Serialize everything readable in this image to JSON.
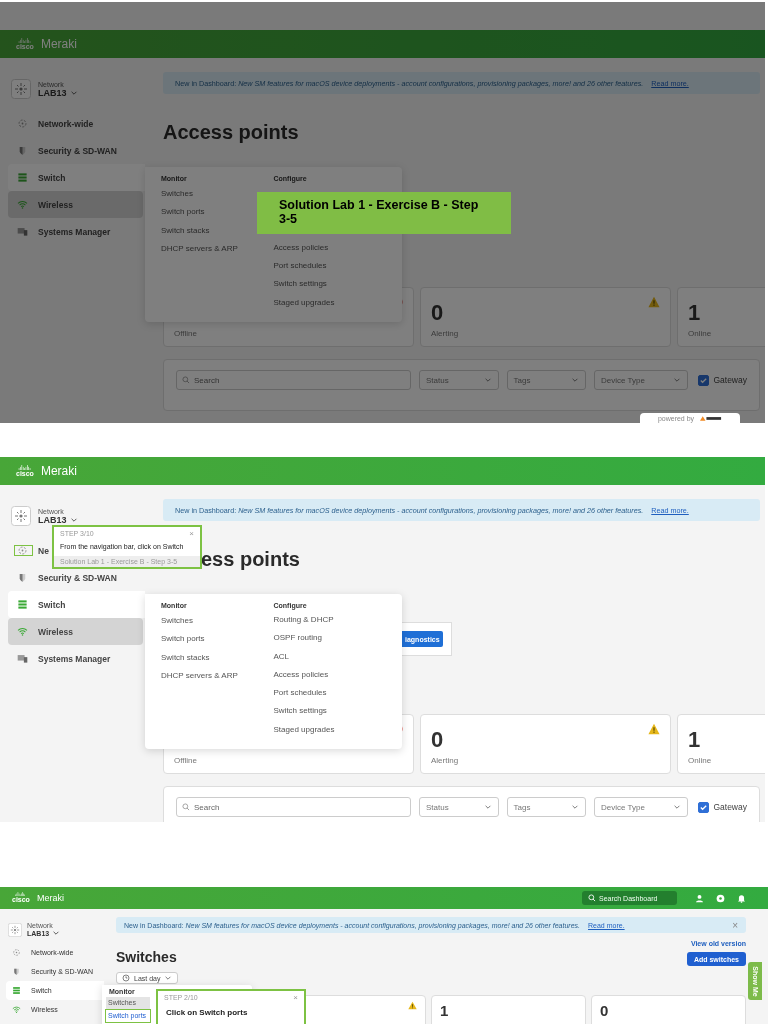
{
  "panels": [
    {
      "kind": "access_points",
      "dimmed": true,
      "header": {
        "logo": "cisco",
        "brand": "Meraki"
      },
      "network": {
        "label": "Network",
        "name": "LAB13"
      },
      "nav": [
        {
          "label": "Network-wide",
          "selected": false,
          "current": false
        },
        {
          "label": "Security & SD-WAN",
          "selected": false,
          "current": false
        },
        {
          "label": "Switch",
          "selected": true,
          "current": false
        },
        {
          "label": "Wireless",
          "selected": false,
          "current": true
        },
        {
          "label": "Systems Manager",
          "selected": false,
          "current": false
        }
      ],
      "banner": {
        "text": "New in Dashboard: *New SM features for macOS device deployments - account configurations, provisioning packages, more! and 26 other features.*",
        "link": "Read more."
      },
      "title": "Access points",
      "flyout": {
        "columns": [
          {
            "heading": "Monitor",
            "items": [
              {
                "label": "Switches"
              },
              {
                "label": "Switch ports"
              },
              {
                "label": "Switch stacks"
              },
              {
                "label": "DHCP servers & ARP"
              }
            ]
          },
          {
            "heading": "Configure",
            "items": [
              {
                "label": "Access policies"
              },
              {
                "label": "Port schedules"
              },
              {
                "label": "Switch settings"
              },
              {
                "label": "Staged upgrades"
              }
            ]
          }
        ]
      },
      "stats": [
        {
          "label": "Offline",
          "kind": "error"
        },
        {
          "value": "0",
          "label": "Alerting",
          "kind": "warning"
        },
        {
          "value": "1",
          "label": "Online",
          "kind": "plain"
        }
      ],
      "filters": {
        "search_placeholder": "Search",
        "selects": [
          "Status",
          "Tags",
          "Device Type"
        ],
        "checkbox": {
          "label": "Gateway",
          "checked": true
        }
      },
      "step_title": "Solution Lab 1 - Exercise B - Step 3-5",
      "powered_by": "powered by"
    },
    {
      "kind": "access_points",
      "header": {
        "logo": "cisco",
        "brand": "Meraki"
      },
      "network": {
        "label": "Network",
        "name": "LAB13"
      },
      "nav": [
        {
          "label": "Ne",
          "selected": false,
          "current": false,
          "highlighted": true
        },
        {
          "label": "Security & SD-WAN",
          "selected": false,
          "current": false,
          "highlighted": false
        },
        {
          "label": "Switch",
          "selected": true,
          "current": false,
          "highlighted": false
        },
        {
          "label": "Wireless",
          "selected": false,
          "current": true,
          "highlighted": false
        },
        {
          "label": "Systems Manager",
          "selected": false,
          "current": false,
          "highlighted": false
        }
      ],
      "banner": {
        "text": "New in Dashboard: *New SM features for macOS device deployments - account configurations, provisioning packages, more! and 26 other features.*",
        "link": "Read more."
      },
      "title": "ess points",
      "diagnostics_button": "iagnostics",
      "flyout": {
        "columns": [
          {
            "heading": "Monitor",
            "items": [
              {
                "label": "Switches"
              },
              {
                "label": "Switch ports"
              },
              {
                "label": "Switch stacks"
              },
              {
                "label": "DHCP servers & ARP"
              }
            ]
          },
          {
            "heading": "Configure",
            "items": [
              {
                "label": "Routing & DHCP"
              },
              {
                "label": "OSPF routing"
              },
              {
                "label": "ACL"
              },
              {
                "label": "Access policies"
              },
              {
                "label": "Port schedules"
              },
              {
                "label": "Switch settings"
              },
              {
                "label": "Staged upgrades"
              }
            ]
          }
        ]
      },
      "stats": [
        {
          "label": "Offline",
          "kind": "error"
        },
        {
          "value": "0",
          "label": "Alerting",
          "kind": "warning"
        },
        {
          "value": "1",
          "label": "Online",
          "kind": "plain"
        }
      ],
      "filters": {
        "search_placeholder": "Search",
        "selects": [
          "Status",
          "Tags",
          "Device Type"
        ],
        "checkbox": {
          "label": "Gateway",
          "checked": true
        }
      },
      "tooltip": {
        "step": "STEP 3/10",
        "close": "×",
        "text": "From the navigation bar, click on Switch",
        "footer": "Solution Lab 1 - Exercise B - Step 3-5"
      }
    },
    {
      "kind": "switches",
      "header": {
        "logo": "cisco",
        "brand": "Meraki",
        "search_placeholder": "Search Dashboard"
      },
      "network": {
        "label": "Network",
        "name": "LAB13"
      },
      "nav": [
        {
          "label": "Network-wide",
          "selected": false,
          "current": false
        },
        {
          "label": "Security & SD-WAN",
          "selected": false,
          "current": false
        },
        {
          "label": "Switch",
          "selected": true,
          "current": false
        },
        {
          "label": "Wireless",
          "selected": false,
          "current": false
        }
      ],
      "banner": {
        "text": "New in Dashboard: *New SM features for macOS device deployments - account configurations, provisioning packages, more! and 26 other features.*",
        "link": "Read more.",
        "close": "×"
      },
      "title": "Switches",
      "actions": {
        "link": "View old version",
        "button": "Add switches"
      },
      "time_range": "Last day",
      "flyout": {
        "columns": [
          {
            "heading": "Monitor",
            "items": [
              {
                "label": "Switches",
                "hovered": true,
                "highlighted": false
              },
              {
                "label": "Switch ports",
                "hovered": false,
                "highlighted": true
              }
            ]
          }
        ]
      },
      "stats": [
        {
          "kind": "warning"
        },
        {
          "value": "1",
          "kind": "plain"
        },
        {
          "value": "0",
          "kind": "plain"
        }
      ],
      "tooltip": {
        "step": "STEP 2/10",
        "close": "×",
        "text": "Click on Switch ports"
      },
      "show_me": "Show Me"
    }
  ]
}
